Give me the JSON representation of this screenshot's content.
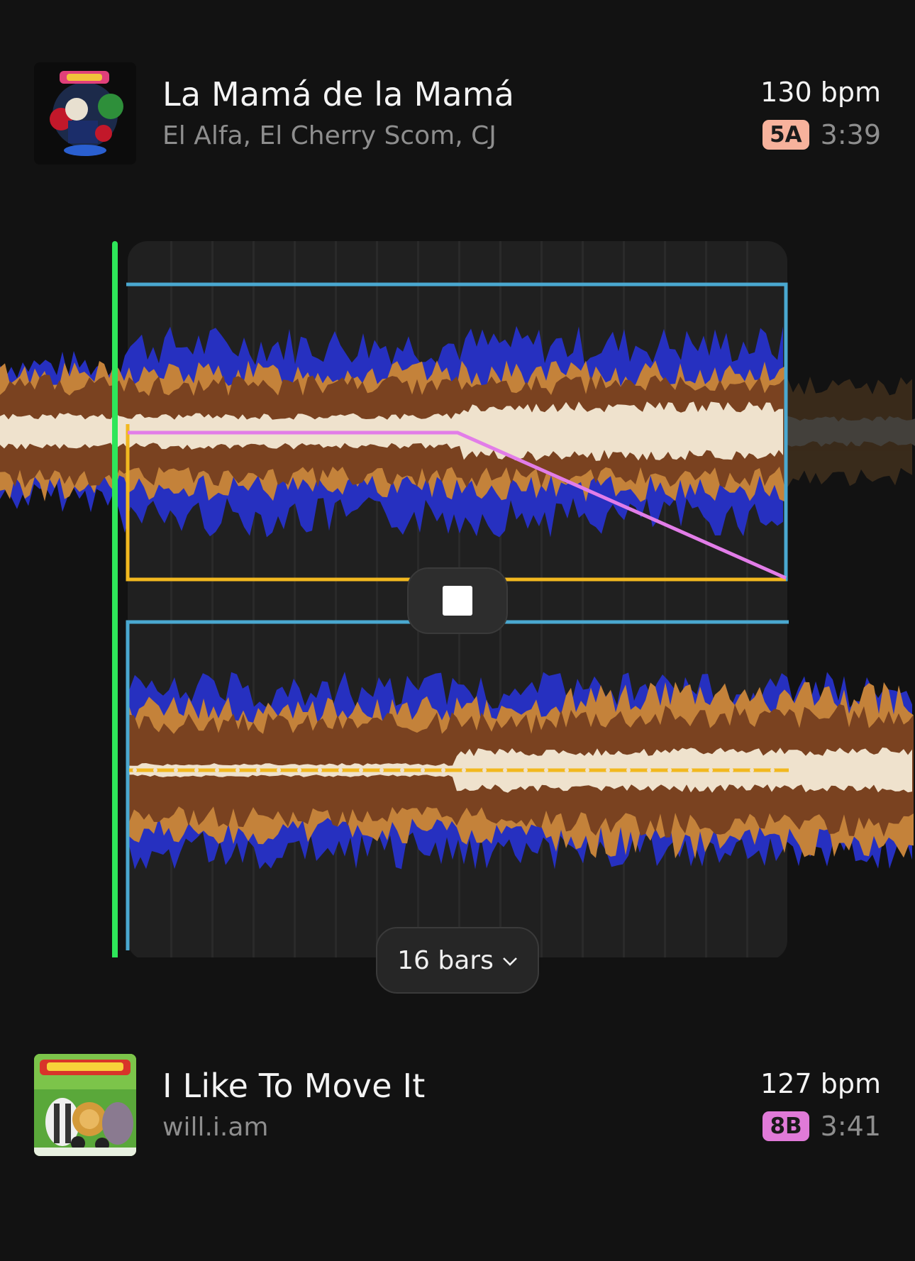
{
  "tracks": {
    "top": {
      "title": "La Mamá de la Mamá",
      "artist": "El Alfa, El Cherry Scom, CJ",
      "bpm": "130 bpm",
      "key": "5A",
      "key_color": "#f7b29c",
      "duration": "3:39"
    },
    "bottom": {
      "title": "I Like To Move It",
      "artist": "will.i.am",
      "bpm": "127 bpm",
      "key": "8B",
      "key_color": "#e07ad8",
      "duration": "3:41"
    }
  },
  "transition": {
    "length_label": "16 bars",
    "icons": {
      "stop": "stop-icon",
      "dropdown": "chevron-down-icon"
    }
  },
  "colors": {
    "background": "#121212",
    "panel": "#202020",
    "playhead": "#2ee65a",
    "outline": "#4aa8d0",
    "volume_line": "#f2b81f",
    "filter_line": "#e27de8",
    "wave_low": "#2630c0",
    "wave_mid": "#7a4220",
    "wave_mid_light": "#c4823a",
    "wave_high": "#efe2cd"
  }
}
